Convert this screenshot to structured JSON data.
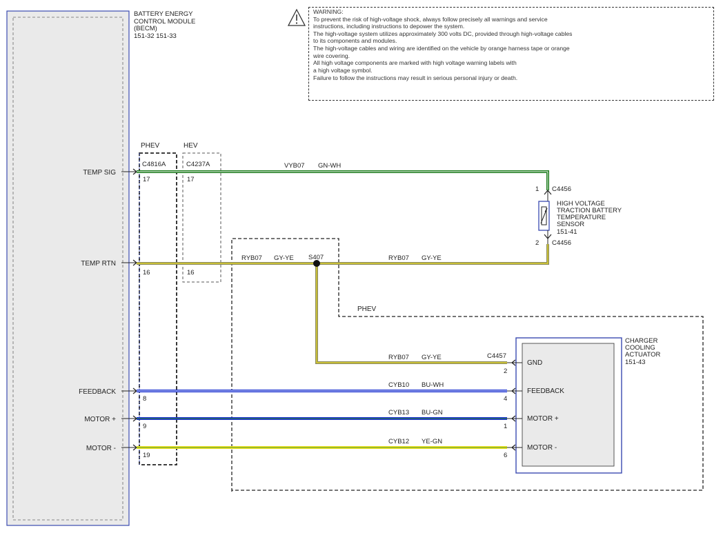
{
  "warning": {
    "heading": "WARNING:",
    "lines": [
      "To prevent the risk of high-voltage shock, always follow precisely all warnings and service",
      "instructions, including instructions to depower the system.",
      "The high-voltage system utilizes approximately 300 volts DC, provided through high-voltage cables",
      "to its components and modules.",
      "The high-voltage cables and wiring are identified on the vehicle by orange harness tape or orange",
      "wire covering.",
      "All high voltage components are marked with high voltage warning labels with",
      "a high voltage symbol.",
      "Failure to follow the instructions may result in serious personal injury or death."
    ]
  },
  "becm": {
    "title_lines": [
      "BATTERY ENERGY",
      "CONTROL MODULE",
      "(BECM)",
      "151-32  151-33"
    ],
    "pins": [
      "TEMP SIG",
      "TEMP RTN",
      "FEEDBACK",
      "MOTOR +",
      "MOTOR -"
    ]
  },
  "connectors": {
    "phev_label": "PHEV",
    "hev_label": "HEV",
    "phev_id": "C4816A",
    "hev_id": "C4237A",
    "phev_pins": [
      "17",
      "16",
      "8",
      "9",
      "19"
    ],
    "hev_pins": [
      "17",
      "16"
    ]
  },
  "splice": {
    "id": "S407",
    "region_label": "PHEV"
  },
  "wires": [
    {
      "circuit": "VYB07",
      "color_code": "GN-WH"
    },
    {
      "circuit": "RYB07",
      "color_code": "GY-YE"
    },
    {
      "circuit": "RYB07",
      "color_code": "GY-YE"
    },
    {
      "circuit": "RYB07",
      "color_code": "GY-YE"
    },
    {
      "circuit": "CYB10",
      "color_code": "BU-WH"
    },
    {
      "circuit": "CYB13",
      "color_code": "BU-GN"
    },
    {
      "circuit": "CYB12",
      "color_code": "YE-GN"
    }
  ],
  "sensor": {
    "title_lines": [
      "HIGH VOLTAGE",
      "TRACTION BATTERY",
      "TEMPERATURE",
      "SENSOR"
    ],
    "ref": "151-41",
    "connector": "C4456",
    "pin_top": "1",
    "pin_bottom": "2"
  },
  "actuator": {
    "title_lines": [
      "CHARGER",
      "COOLING",
      "ACTUATOR"
    ],
    "ref": "151-43",
    "connector": "C4457",
    "pins": [
      {
        "name": "GND",
        "num": "2"
      },
      {
        "name": "FEEDBACK",
        "num": "4"
      },
      {
        "name": "MOTOR +",
        "num": "1"
      },
      {
        "name": "MOTOR -",
        "num": "6"
      }
    ]
  },
  "colors": {
    "green": "#1a7a1a",
    "green_stripe": "#ffffff",
    "gray": "#8a8a60",
    "yellow": "#f0e020",
    "blue": "#1a30d0",
    "blue_stripe": "#ffffff",
    "blue_green_stripe": "#2a8a2a",
    "yellow_green_stripe": "#4a9a2a",
    "module_fill": "#eaeaea",
    "module_border": "#3a4ab0"
  }
}
